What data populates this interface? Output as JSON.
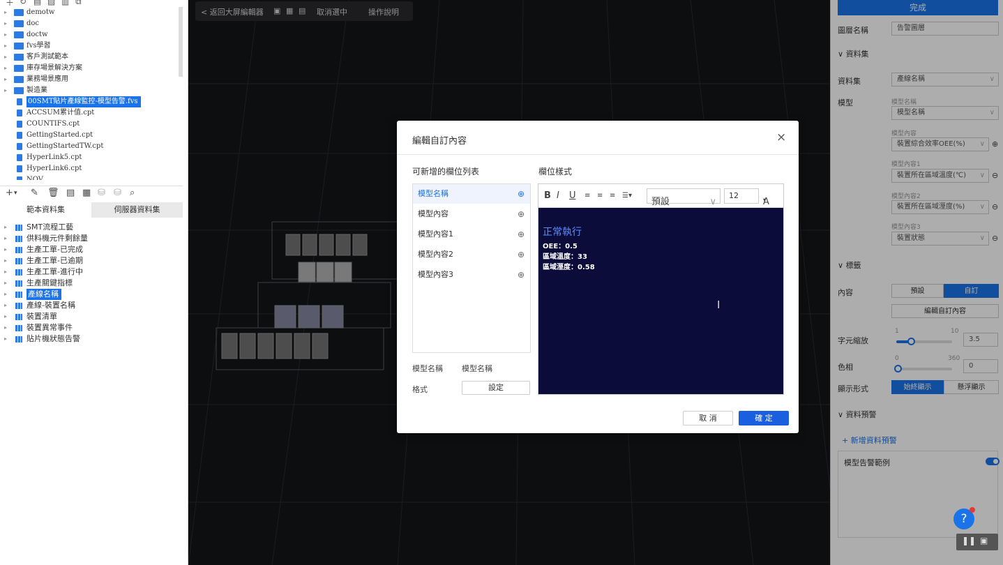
{
  "left_toolbar_top": [
    "＋",
    "↻",
    "▤",
    "▨",
    "▥",
    "⧉"
  ],
  "tree1": [
    {
      "label": "demotw",
      "type": "folder"
    },
    {
      "label": "doc",
      "type": "folder"
    },
    {
      "label": "doctw",
      "type": "folder"
    },
    {
      "label": "fvs學習",
      "type": "folder"
    },
    {
      "label": "客戶測試範本",
      "type": "folder"
    },
    {
      "label": "庫存場景解決方案",
      "type": "folder"
    },
    {
      "label": "業務場景應用",
      "type": "folder"
    },
    {
      "label": "製造業",
      "type": "folder"
    },
    {
      "label": "00SMT貼片產線監控-模型告警.fvs",
      "type": "file",
      "selected": true
    },
    {
      "label": "ACCSUM累计值.cpt",
      "type": "file"
    },
    {
      "label": "COUNTIFS.cpt",
      "type": "file"
    },
    {
      "label": "GettingStarted.cpt",
      "type": "file"
    },
    {
      "label": "GettingStartedTW.cpt",
      "type": "file"
    },
    {
      "label": "HyperLink5.cpt",
      "type": "file"
    },
    {
      "label": "HyperLink6.cpt",
      "type": "file"
    },
    {
      "label": "NOV...",
      "type": "file"
    }
  ],
  "ds_tabs": [
    "範本資料集",
    "伺服器資料集"
  ],
  "datasets": [
    {
      "label": "SMT流程工藝"
    },
    {
      "label": "供料機元件剩餘量"
    },
    {
      "label": "生產工單-已完成"
    },
    {
      "label": "生產工單-已逾期"
    },
    {
      "label": "生產工單-進行中"
    },
    {
      "label": "生產關鍵指標"
    },
    {
      "label": "產線名稱",
      "selected": true
    },
    {
      "label": "產線-裝置名稱"
    },
    {
      "label": "裝置清單"
    },
    {
      "label": "裝置異常事件"
    },
    {
      "label": "貼片機狀態告警"
    }
  ],
  "topbar": {
    "back": "< 返回大屏編輯器",
    "deselect": "取消選中",
    "help": "操作說明"
  },
  "dialog": {
    "title": "編輯自訂內容",
    "close": "×",
    "field_list_title": "可新增的欄位列表",
    "field_style_title": "欄位樣式",
    "fields": [
      "模型名稱",
      "模型內容",
      "模型內容1",
      "模型內容2",
      "模型內容3"
    ],
    "footer_label1": "模型名稱",
    "footer_value1": "模型名稱",
    "format_label": "格式",
    "set_button": "設定",
    "toolbar": {
      "bold": "B",
      "italic": "I",
      "underline": "U",
      "font": "預設",
      "size": "12",
      "color": "A"
    },
    "content": {
      "line1": "正常執行",
      "line2": "OEE：0.5",
      "line3": "區域溫度：33",
      "line4": "區域溼度：0.58"
    },
    "cancel": "取 消",
    "ok": "確 定"
  },
  "right": {
    "done": "完成",
    "layer_name_label": "圖層名稱",
    "layer_name_value": "告警圖層",
    "section_dataset": "資料集",
    "dataset_label": "資料集",
    "dataset_value": "產線名稱",
    "model_label": "模型",
    "model_name_sub": "模型名稱",
    "model_name_value": "模型名稱",
    "mc_sub": "模型內容",
    "mc_value": "裝置綜合效率OEE(%)",
    "mc1_sub": "模型內容1",
    "mc1_value": "裝置所在區域溫度(℃)",
    "mc2_sub": "模型內容2",
    "mc2_value": "裝置所在區域溼度(%)",
    "mc3_sub": "模型內容3",
    "mc3_value": "裝置狀態",
    "section_label": "標籤",
    "content_label": "內容",
    "content_default": "預設",
    "content_custom": "自訂",
    "edit_custom_btn": "編輯自訂內容",
    "scale_label": "字元縮放",
    "scale_min": "1",
    "scale_max": "10",
    "scale_value": "3.5",
    "hue_label": "色相",
    "hue_min": "0",
    "hue_max": "360",
    "hue_value": "0",
    "display_label": "顯示形式",
    "display_always": "始終顯示",
    "display_hover": "懸浮顯示",
    "section_alert": "資料預警",
    "add_alert": "+ 新增資料預警",
    "alert_item": "模型告警範例",
    "help": "?"
  }
}
